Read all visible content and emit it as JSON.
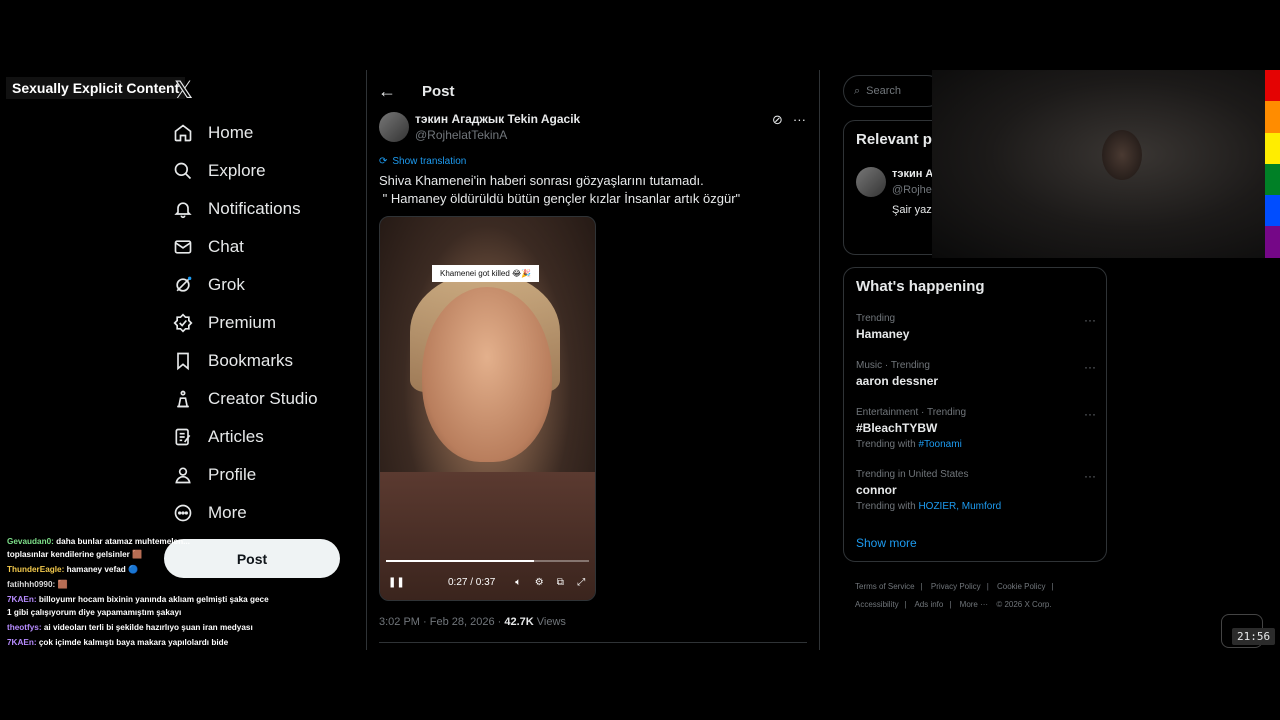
{
  "overlay": {
    "content_warning": "Sexually Explicit Content"
  },
  "nav": {
    "items": [
      {
        "label": "Home",
        "icon": "home-icon"
      },
      {
        "label": "Explore",
        "icon": "search-icon"
      },
      {
        "label": "Notifications",
        "icon": "bell-icon"
      },
      {
        "label": "Chat",
        "icon": "mail-icon"
      },
      {
        "label": "Grok",
        "icon": "grok-icon"
      },
      {
        "label": "Premium",
        "icon": "premium-icon"
      },
      {
        "label": "Bookmarks",
        "icon": "bookmark-icon"
      },
      {
        "label": "Creator Studio",
        "icon": "creator-icon"
      },
      {
        "label": "Articles",
        "icon": "articles-icon"
      },
      {
        "label": "Profile",
        "icon": "profile-icon"
      },
      {
        "label": "More",
        "icon": "more-icon"
      }
    ],
    "post_button": "Post"
  },
  "chat": [
    {
      "user": "Gevaudan0:",
      "text": "daha bunlar atamaz muhtemelen..."
    },
    {
      "user": "",
      "text": "toplasınlar kendilerine gelsinler"
    },
    {
      "user": "ThunderEagle:",
      "text": "hamaney vefad"
    },
    {
      "user": "fatihhh0990:",
      "text": ""
    },
    {
      "user": "7KAEn:",
      "text": "billoyumr hocam bixinin yanında aklıam gelmişti şaka gece 1 gibi çalışıyorum diye yapamamıştım şakayı"
    },
    {
      "user": "theotfys:",
      "text": "ai videoları terli bi şekilde hazırlıyo şuan iran medyası"
    },
    {
      "user": "7KAEn:",
      "text": "çok içimde kalmıştı baya makara yapılolardı bide"
    }
  ],
  "main": {
    "title": "Post",
    "author": {
      "name": "тэкин Агаджык Tekin Agacik",
      "handle": "@RojhelatTekinA"
    },
    "show_translation": "Show translation",
    "text_line1": "Shiva Khamenei'in haberi sonrası gözyaşlarını tutamadı.",
    "text_line2": " \" Hamaney öldürüldü bütün gençler kızlar İnsanlar artık özgür\"",
    "video": {
      "caption": "Khamenei got killed 😂🎉",
      "time": "0:27 / 0:37",
      "progress": 0.73
    },
    "timestamp": "3:02 PM · Feb 28, 2026 · ",
    "views_count": "42.7K",
    "views_label": " Views"
  },
  "right": {
    "search_placeholder": "Search",
    "relevant": {
      "title": "Relevant p",
      "name": "тэкин А",
      "handle": "@Rojhe",
      "bio": "Şair yaz culture, Human"
    },
    "happening_title": "What's happening",
    "trends": [
      {
        "context": "Trending",
        "name": "Hamaney",
        "with_label": "",
        "with_tags": ""
      },
      {
        "context": "Music · Trending",
        "name": "aaron dessner",
        "with_label": "",
        "with_tags": ""
      },
      {
        "context": "Entertainment · Trending",
        "name": "#BleachTYBW",
        "with_label": "Trending with ",
        "with_tags": "#Toonami"
      },
      {
        "context": "Trending in United States",
        "name": "connor",
        "with_label": "Trending with ",
        "with_tags": "HOZIER, Mumford"
      }
    ],
    "show_more": "Show more",
    "footer": [
      "Terms of Service",
      "|",
      "Privacy Policy",
      "|",
      "Cookie Policy",
      "|",
      "Accessibility",
      "|",
      "Ads info",
      "|",
      "More ···",
      "© 2026 X Corp."
    ]
  },
  "clock": "21:56",
  "colors": {
    "accent": "#1d9bf0",
    "bg": "#000000",
    "border": "#2f3336",
    "muted": "#71767b"
  }
}
